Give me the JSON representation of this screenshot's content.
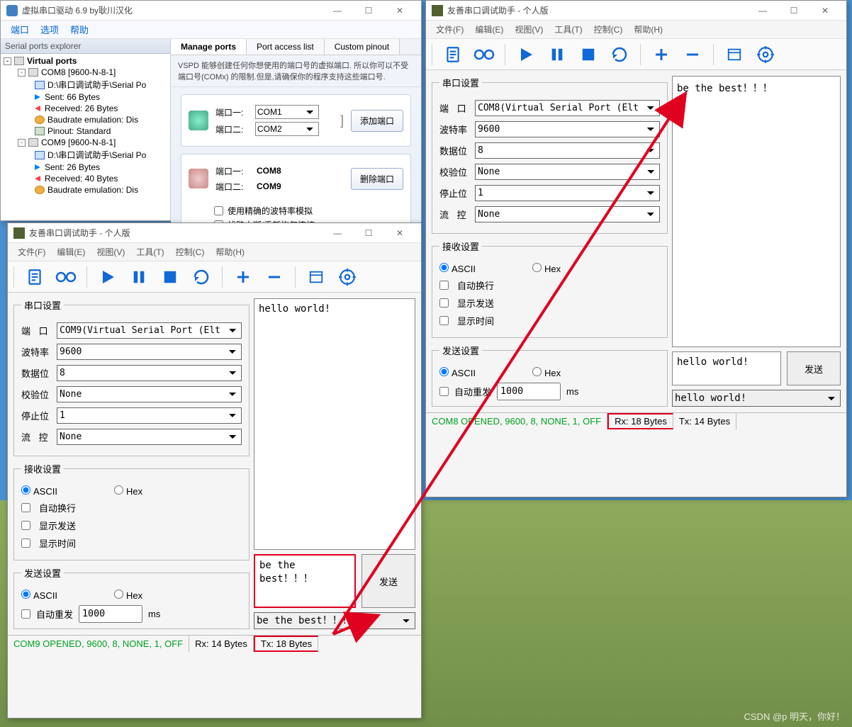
{
  "vspd": {
    "title": "虚拟串口驱动 6.9 by耿川汉化",
    "menu": [
      "端口",
      "选项",
      "帮助"
    ],
    "explorer_header": "Serial ports explorer",
    "tree_root": "Virtual ports",
    "com8": {
      "name": "COM8 [9600-N-8-1]",
      "path": "D:\\串口调试助手\\Serial Po",
      "sent": "Sent: 66 Bytes",
      "recv": "Received: 26 Bytes",
      "baud": "Baudrate emulation: Dis",
      "pinout": "Pinout: Standard"
    },
    "com9": {
      "name": "COM9 [9600-N-8-1]",
      "path": "D:\\串口调试助手\\Serial Po",
      "sent": "Sent: 26 Bytes",
      "recv": "Received: 40 Bytes",
      "baud": "Baudrate emulation: Dis"
    },
    "tabs": [
      "Manage ports",
      "Port access list",
      "Custom pinout"
    ],
    "desc": "VSPD 能够创建任何你想使用的端口号的虚拟端口. 所以你可以不受端口号(COMx) 的限制.但是,请确保你的程序支持这些端口号.",
    "add": {
      "port1_lbl": "端口一:",
      "port1_val": "COM1",
      "port2_lbl": "端口二:",
      "port2_val": "COM2",
      "btn": "添加端口"
    },
    "del": {
      "port1_lbl": "端口一:",
      "port1_val": "COM8",
      "port2_lbl": "端口二:",
      "port2_val": "COM9",
      "btn": "删除端口",
      "chk1": "使用精确的波特率模拟",
      "chk2": "线路中断/重新恢复连接"
    }
  },
  "serA": {
    "title": "友善串口调试助手 - 个人版",
    "menu": [
      "文件(F)",
      "编辑(E)",
      "视图(V)",
      "工具(T)",
      "控制(C)",
      "帮助(H)"
    ],
    "group_serial": "串口设置",
    "port_lbl": "端 口",
    "port_val": "COM9(Virtual Serial Port (Elt",
    "baud_lbl": "波特率",
    "baud_val": "9600",
    "data_lbl": "数据位",
    "data_val": "8",
    "parity_lbl": "校验位",
    "parity_val": "None",
    "stop_lbl": "停止位",
    "stop_val": "1",
    "flow_lbl": "流 控",
    "flow_val": "None",
    "group_recv": "接收设置",
    "ascii": "ASCII",
    "hex": "Hex",
    "wrap": "自动换行",
    "showsend": "显示发送",
    "showtime": "显示时间",
    "group_send": "发送设置",
    "autosend": "自动重发",
    "autosend_val": "1000",
    "ms": "ms",
    "rx_text": "hello world!",
    "tx_text": "be the best！！！",
    "send_btn": "发送",
    "history": "be the best！！！",
    "status_open": "COM9 OPENED, 9600, 8, NONE, 1, OFF",
    "status_rx": "Rx: 14 Bytes",
    "status_tx": "Tx: 18 Bytes"
  },
  "serB": {
    "title": "友善串口调试助手 - 个人版",
    "menu": [
      "文件(F)",
      "编辑(E)",
      "视图(V)",
      "工具(T)",
      "控制(C)",
      "帮助(H)"
    ],
    "group_serial": "串口设置",
    "port_lbl": "端 口",
    "port_val": "COM8(Virtual Serial Port (Elt",
    "baud_lbl": "波特率",
    "baud_val": "9600",
    "data_lbl": "数据位",
    "data_val": "8",
    "parity_lbl": "校验位",
    "parity_val": "None",
    "stop_lbl": "停止位",
    "stop_val": "1",
    "flow_lbl": "流 控",
    "flow_val": "None",
    "group_recv": "接收设置",
    "ascii": "ASCII",
    "hex": "Hex",
    "wrap": "自动换行",
    "showsend": "显示发送",
    "showtime": "显示时间",
    "group_send": "发送设置",
    "autosend": "自动重发",
    "autosend_val": "1000",
    "ms": "ms",
    "rx_text": "be the best！！！",
    "tx_text": "hello world!",
    "send_btn": "发送",
    "history": "hello world!",
    "status_open": "COM8 OPENED, 9600, 8, NONE, 1, OFF",
    "status_rx": "Rx: 18 Bytes",
    "status_tx": "Tx: 14 Bytes"
  },
  "watermark": "CSDN @p 明天，你好！"
}
